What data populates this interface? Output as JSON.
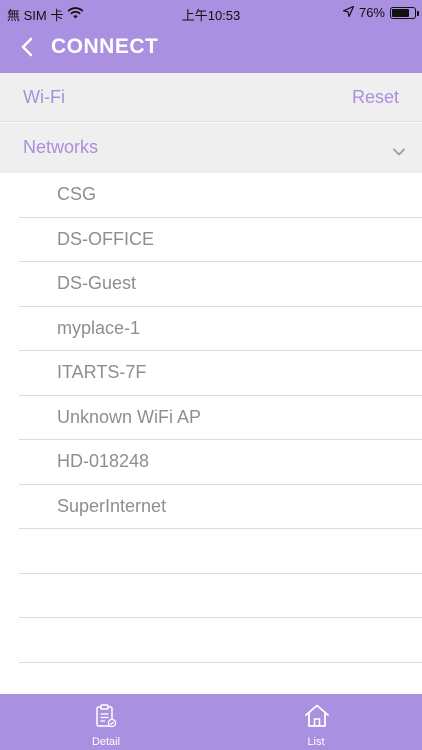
{
  "status_bar": {
    "carrier": "無 SIM 卡",
    "time": "上午10:53",
    "battery_percent": "76%",
    "battery_level": 0.76,
    "icons": [
      "wifi-icon",
      "location-arrow-icon",
      "battery-icon"
    ]
  },
  "nav": {
    "title": "CONNECT",
    "back_icon": "chevron-left-icon"
  },
  "wifi_section": {
    "label": "Wi-Fi",
    "reset_label": "Reset"
  },
  "networks_section": {
    "label": "Networks",
    "chevron_icon": "chevron-down-icon"
  },
  "networks": [
    "CSG",
    "DS-OFFICE",
    "DS-Guest",
    "myplace-1",
    "ITARTS-7F",
    "Unknown WiFi AP",
    "HD-018248",
    "SuperInternet"
  ],
  "tabs": [
    {
      "label": "Detail",
      "icon": "clipboard-icon"
    },
    {
      "label": "List",
      "icon": "home-icon"
    }
  ],
  "colors": {
    "accent": "#a990e0",
    "section_text": "#a98fdc",
    "item_text": "#8e8e8e",
    "section_bg": "#efefef"
  }
}
